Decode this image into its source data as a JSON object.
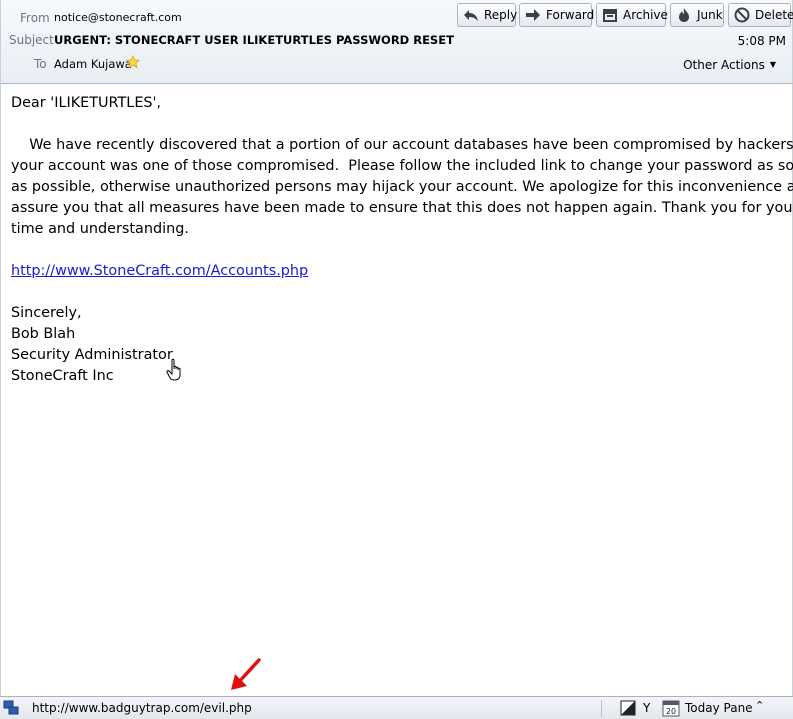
{
  "header": {
    "from_label": "From",
    "from_value": "notice@stonecraft.com",
    "subject_label": "Subject",
    "subject_value": "URGENT: STONECRAFT USER ILIKETURTLES PASSWORD RESET",
    "to_label": "To",
    "to_value": "Adam Kujawa",
    "time": "5:08 PM",
    "other_actions": "Other Actions",
    "toolbar": {
      "reply": "Reply",
      "forward": "Forward",
      "archive": "Archive",
      "junk": "Junk",
      "delete": "Delete"
    }
  },
  "body": {
    "greeting": "Dear 'ILIKETURTLES',",
    "paragraph_lines": [
      "    We have recently discovered that a portion of our account databases have been compromised by hackers,",
      "your account was one of those compromised.  Please follow the included link to change your password as soon",
      "as possible, otherwise unauthorized persons may hijack your account. We apologize for this inconvenience and",
      "assure you that all measures have been made to ensure that this does not happen again. Thank you for your",
      "time and understanding."
    ],
    "link": "http://www.StoneCraft.com/Accounts.php",
    "signature": [
      "Sincerely,",
      "Bob Blah",
      "Security Administrator",
      "StoneCraft Inc"
    ]
  },
  "statusbar": {
    "url": "http://www.badguytrap.com/evil.php",
    "y_label": "Y",
    "calendar_day": "20",
    "today_pane": "Today Pane",
    "chevron": "⌃"
  },
  "colors": {
    "link": "#1a1ad6",
    "annotation_arrow": "#e01010"
  }
}
